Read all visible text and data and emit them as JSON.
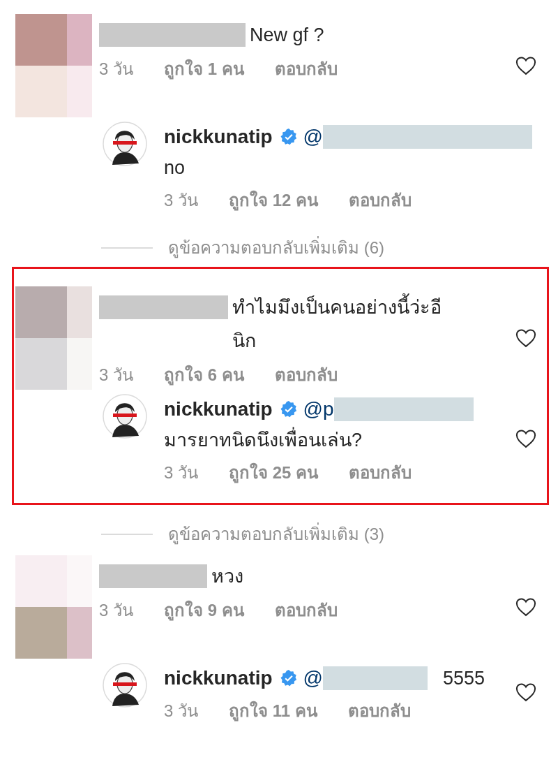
{
  "threads": [
    {
      "highlighted": false,
      "comment": {
        "text": "New gf ?",
        "time": "3 วัน",
        "likes": "ถูกใจ 1 คน",
        "reply": "ตอบกลับ"
      },
      "replies": [
        {
          "username": "nickkunatip",
          "verified": true,
          "mention": "@",
          "text": "no",
          "time": "3 วัน",
          "likes": "ถูกใจ 12 คน",
          "reply": "ตอบกลับ"
        }
      ],
      "view_more": "ดูข้อความตอบกลับเพิ่มเติม (6)"
    },
    {
      "highlighted": true,
      "comment": {
        "text": "ทำไมมึงเป็นคนอย่างนี้ว่ะอีนิก",
        "time": "3 วัน",
        "likes": "ถูกใจ 6 คน",
        "reply": "ตอบกลับ"
      },
      "replies": [
        {
          "username": "nickkunatip",
          "verified": true,
          "mention": "@p",
          "text": "มารยาทนิดนึงเพื่อนเล่น?",
          "time": "3 วัน",
          "likes": "ถูกใจ 25 คน",
          "reply": "ตอบกลับ"
        }
      ],
      "view_more": "ดูข้อความตอบกลับเพิ่มเติม (3)"
    },
    {
      "highlighted": false,
      "comment": {
        "text": "หวง",
        "time": "3 วัน",
        "likes": "ถูกใจ 9 คน",
        "reply": "ตอบกลับ"
      },
      "replies": [
        {
          "username": "nickkunatip",
          "verified": true,
          "mention": "@",
          "after_mention": "5555",
          "time": "3 วัน",
          "likes": "ถูกใจ 11 คน",
          "reply": "ตอบกลับ"
        }
      ]
    }
  ]
}
